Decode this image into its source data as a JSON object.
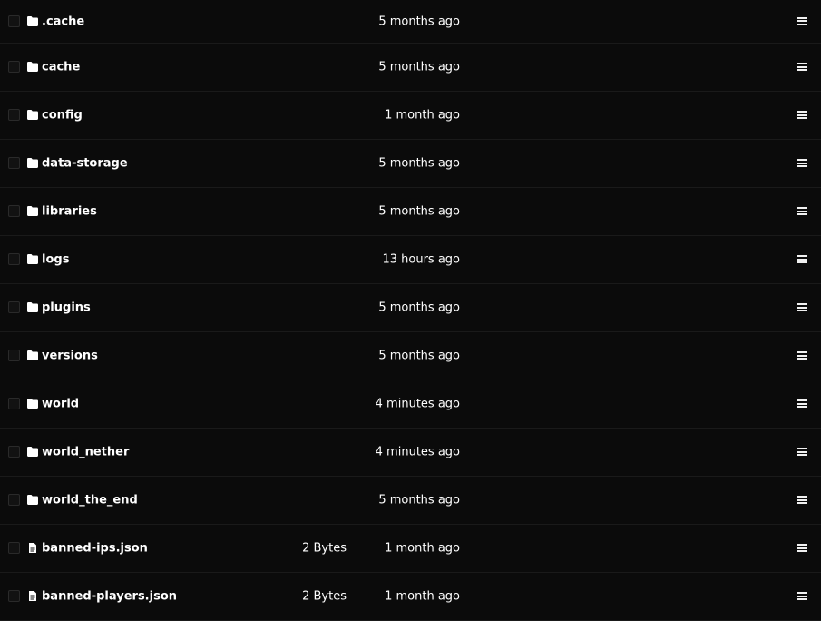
{
  "entries": [
    {
      "type": "folder",
      "name": ".cache",
      "size": "",
      "modified": "5 months ago"
    },
    {
      "type": "folder",
      "name": "cache",
      "size": "",
      "modified": "5 months ago"
    },
    {
      "type": "folder",
      "name": "config",
      "size": "",
      "modified": "1 month ago"
    },
    {
      "type": "folder",
      "name": "data-storage",
      "size": "",
      "modified": "5 months ago"
    },
    {
      "type": "folder",
      "name": "libraries",
      "size": "",
      "modified": "5 months ago"
    },
    {
      "type": "folder",
      "name": "logs",
      "size": "",
      "modified": "13 hours ago"
    },
    {
      "type": "folder",
      "name": "plugins",
      "size": "",
      "modified": "5 months ago"
    },
    {
      "type": "folder",
      "name": "versions",
      "size": "",
      "modified": "5 months ago"
    },
    {
      "type": "folder",
      "name": "world",
      "size": "",
      "modified": "4 minutes ago"
    },
    {
      "type": "folder",
      "name": "world_nether",
      "size": "",
      "modified": "4 minutes ago"
    },
    {
      "type": "folder",
      "name": "world_the_end",
      "size": "",
      "modified": "5 months ago"
    },
    {
      "type": "file",
      "name": "banned-ips.json",
      "size": "2 Bytes",
      "modified": "1 month ago"
    },
    {
      "type": "file",
      "name": "banned-players.json",
      "size": "2 Bytes",
      "modified": "1 month ago"
    }
  ],
  "icons": {
    "folder": "folder-icon",
    "file": "file-icon",
    "menu": "menu-icon"
  },
  "colors": {
    "background": "#0b0b0b",
    "text": "#ffffff",
    "divider": "#1a1a1a"
  }
}
